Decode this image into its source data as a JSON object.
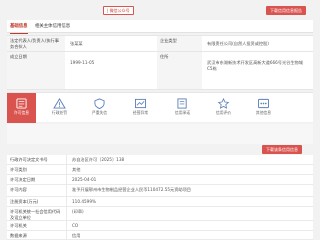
{
  "top": {
    "left_button": "| 微信公众号",
    "right_button": "下载信用信息报告"
  },
  "tabs": [
    {
      "label": "基础信息",
      "active": true
    },
    {
      "label": "相关主体信用信息",
      "active": false
    }
  ],
  "info": {
    "legal_rep_label": "法定代表人/负责人/执行事务合伙人",
    "legal_rep_value": "张某某",
    "enterprise_type_label": "企业类型",
    "enterprise_type_value": "有限责任公司(自然人投资或控股)",
    "established_label": "成立日期",
    "established_value": "1999-11-05",
    "address_label": "住所",
    "address_value": "武汉市东湖新技术开发区高新大道666号光谷生物城C5栋"
  },
  "icon_bar": [
    {
      "label": "许可信息",
      "icon": "document-icon",
      "active": true
    },
    {
      "label": "行政处罚",
      "icon": "warning-icon",
      "active": false
    },
    {
      "label": "严重失信",
      "icon": "shield-icon",
      "active": false
    },
    {
      "label": "经营异常",
      "icon": "chart-icon",
      "active": false
    },
    {
      "label": "信用承诺",
      "icon": "pen-icon",
      "active": false
    },
    {
      "label": "信用评价",
      "icon": "star-icon",
      "active": false
    },
    {
      "label": "其他信息",
      "icon": "dots-icon",
      "active": false
    }
  ],
  "sub_header": {
    "left_label": "行政许可",
    "right_button": "下载该条信用信息"
  },
  "detail": [
    {
      "label": "行政许可决定文书号",
      "value": "苏自治区许可〔2025〕138"
    },
    {
      "label": "许可类别",
      "value": "其他"
    },
    {
      "label": "许可决定日期",
      "value": "2025-04-01"
    },
    {
      "label": "许可内容",
      "value": "准予开展鄂州市生物制品经营企业人民币110472.55元资助项目"
    },
    {
      "label": "注册资本(万元)",
      "value": "110.4599%"
    },
    {
      "label": "许可机关统一社会信用代码及设立单位",
      "value": "(印章)"
    },
    {
      "label": "许可机关",
      "value": "CO"
    },
    {
      "label": "数据来源",
      "value": "信用"
    }
  ],
  "colors": {
    "accent": "#d9534f"
  }
}
